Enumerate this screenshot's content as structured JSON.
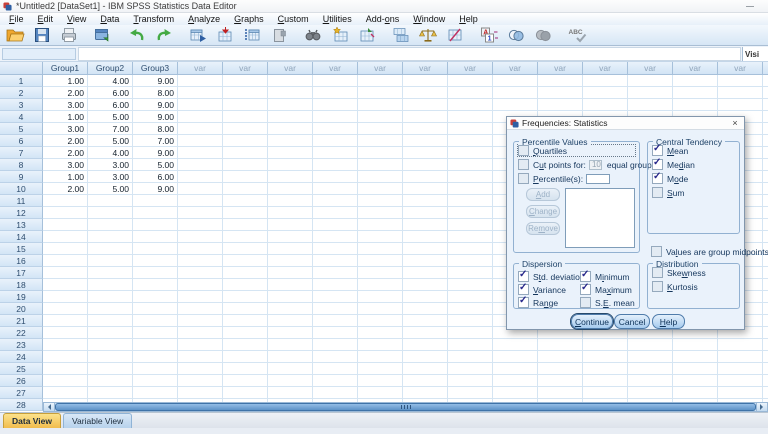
{
  "window": {
    "title": "*Untitled2 [DataSet1] - IBM SPSS Statistics Data Editor"
  },
  "menubar": {
    "items": [
      {
        "label": "File",
        "key": "F"
      },
      {
        "label": "Edit",
        "key": "E"
      },
      {
        "label": "View",
        "key": "V"
      },
      {
        "label": "Data",
        "key": "D"
      },
      {
        "label": "Transform",
        "key": "T"
      },
      {
        "label": "Analyze",
        "key": "A"
      },
      {
        "label": "Graphs",
        "key": "G"
      },
      {
        "label": "Custom",
        "key": "C"
      },
      {
        "label": "Utilities",
        "key": "U"
      },
      {
        "label": "Add-ons",
        "key": "o"
      },
      {
        "label": "Window",
        "key": "W"
      },
      {
        "label": "Help",
        "key": "H"
      }
    ]
  },
  "toolbar": {
    "icons": [
      "open-data",
      "save",
      "print",
      "recall-dialogs",
      "undo",
      "redo",
      "goto-case",
      "goto-variable",
      "variables",
      "file-info",
      "find",
      "insert-cases",
      "insert-variable",
      "split-file",
      "weight-cases",
      "select-cases",
      "value-labels",
      "use-variable-sets",
      "show-all-variables",
      "spell-check"
    ]
  },
  "refbar": {
    "cell_reference": "",
    "cell_editor_value": "",
    "visible_label": "Visi"
  },
  "grid": {
    "variables": [
      "Group1",
      "Group2",
      "Group3"
    ],
    "empty_variable_label": "var",
    "empty_variable_count": 14,
    "visible_row_count": 28,
    "rows": [
      [
        "1.00",
        "4.00",
        "9.00"
      ],
      [
        "2.00",
        "6.00",
        "8.00"
      ],
      [
        "3.00",
        "6.00",
        "9.00"
      ],
      [
        "1.00",
        "5.00",
        "9.00"
      ],
      [
        "3.00",
        "7.00",
        "8.00"
      ],
      [
        "2.00",
        "5.00",
        "7.00"
      ],
      [
        "2.00",
        "4.00",
        "9.00"
      ],
      [
        "3.00",
        "3.00",
        "5.00"
      ],
      [
        "1.00",
        "3.00",
        "6.00"
      ],
      [
        "2.00",
        "5.00",
        "9.00"
      ]
    ]
  },
  "dialog": {
    "title": "Frequencies: Statistics",
    "close_label": "×",
    "percentile_values": {
      "title": "Percentile Values",
      "items": [
        {
          "label": "Quartiles",
          "key": "Q",
          "checked": false,
          "focus": true
        },
        {
          "label": "Cut points for:",
          "key": "u",
          "checked": false,
          "field": "10",
          "field_disabled": true,
          "suffix": "equal groups"
        },
        {
          "label": "Percentile(s):",
          "key": "P",
          "checked": false,
          "field": "",
          "field_disabled": false
        }
      ],
      "buttons": [
        {
          "label": "Add",
          "key": "A"
        },
        {
          "label": "Change",
          "key": "C"
        },
        {
          "label": "Remove",
          "key": "m"
        }
      ]
    },
    "central_tendency": {
      "title": "Central Tendency",
      "items": [
        {
          "label": "Mean",
          "key": "M",
          "checked": true
        },
        {
          "label": "Median",
          "key": "d",
          "checked": true
        },
        {
          "label": "Mode",
          "key": "o",
          "checked": true
        },
        {
          "label": "Sum",
          "key": "S",
          "checked": false
        }
      ]
    },
    "midpoints": {
      "label": "Values are group midpoints",
      "key": "l",
      "checked": false
    },
    "dispersion": {
      "title": "Dispersion",
      "col1": [
        {
          "label": "Std. deviation",
          "key": "t",
          "checked": true
        },
        {
          "label": "Variance",
          "key": "V",
          "checked": true
        },
        {
          "label": "Range",
          "key": "n",
          "checked": true
        }
      ],
      "col2": [
        {
          "label": "Minimum",
          "key": "i",
          "checked": true
        },
        {
          "label": "Maximum",
          "key": "x",
          "checked": true
        },
        {
          "label": "S.E. mean",
          "key": "E",
          "checked": false
        }
      ]
    },
    "distribution": {
      "title": "Distribution",
      "items": [
        {
          "label": "Skewness",
          "key": "w",
          "checked": false
        },
        {
          "label": "Kurtosis",
          "key": "K",
          "checked": false
        }
      ]
    },
    "buttons": [
      {
        "label": "Continue",
        "key": "C",
        "default": true
      },
      {
        "label": "Cancel",
        "key": ""
      },
      {
        "label": "Help",
        "key": "H"
      }
    ]
  },
  "tabs": [
    {
      "label": "Data View",
      "active": true
    },
    {
      "label": "Variable View",
      "active": false
    }
  ]
}
